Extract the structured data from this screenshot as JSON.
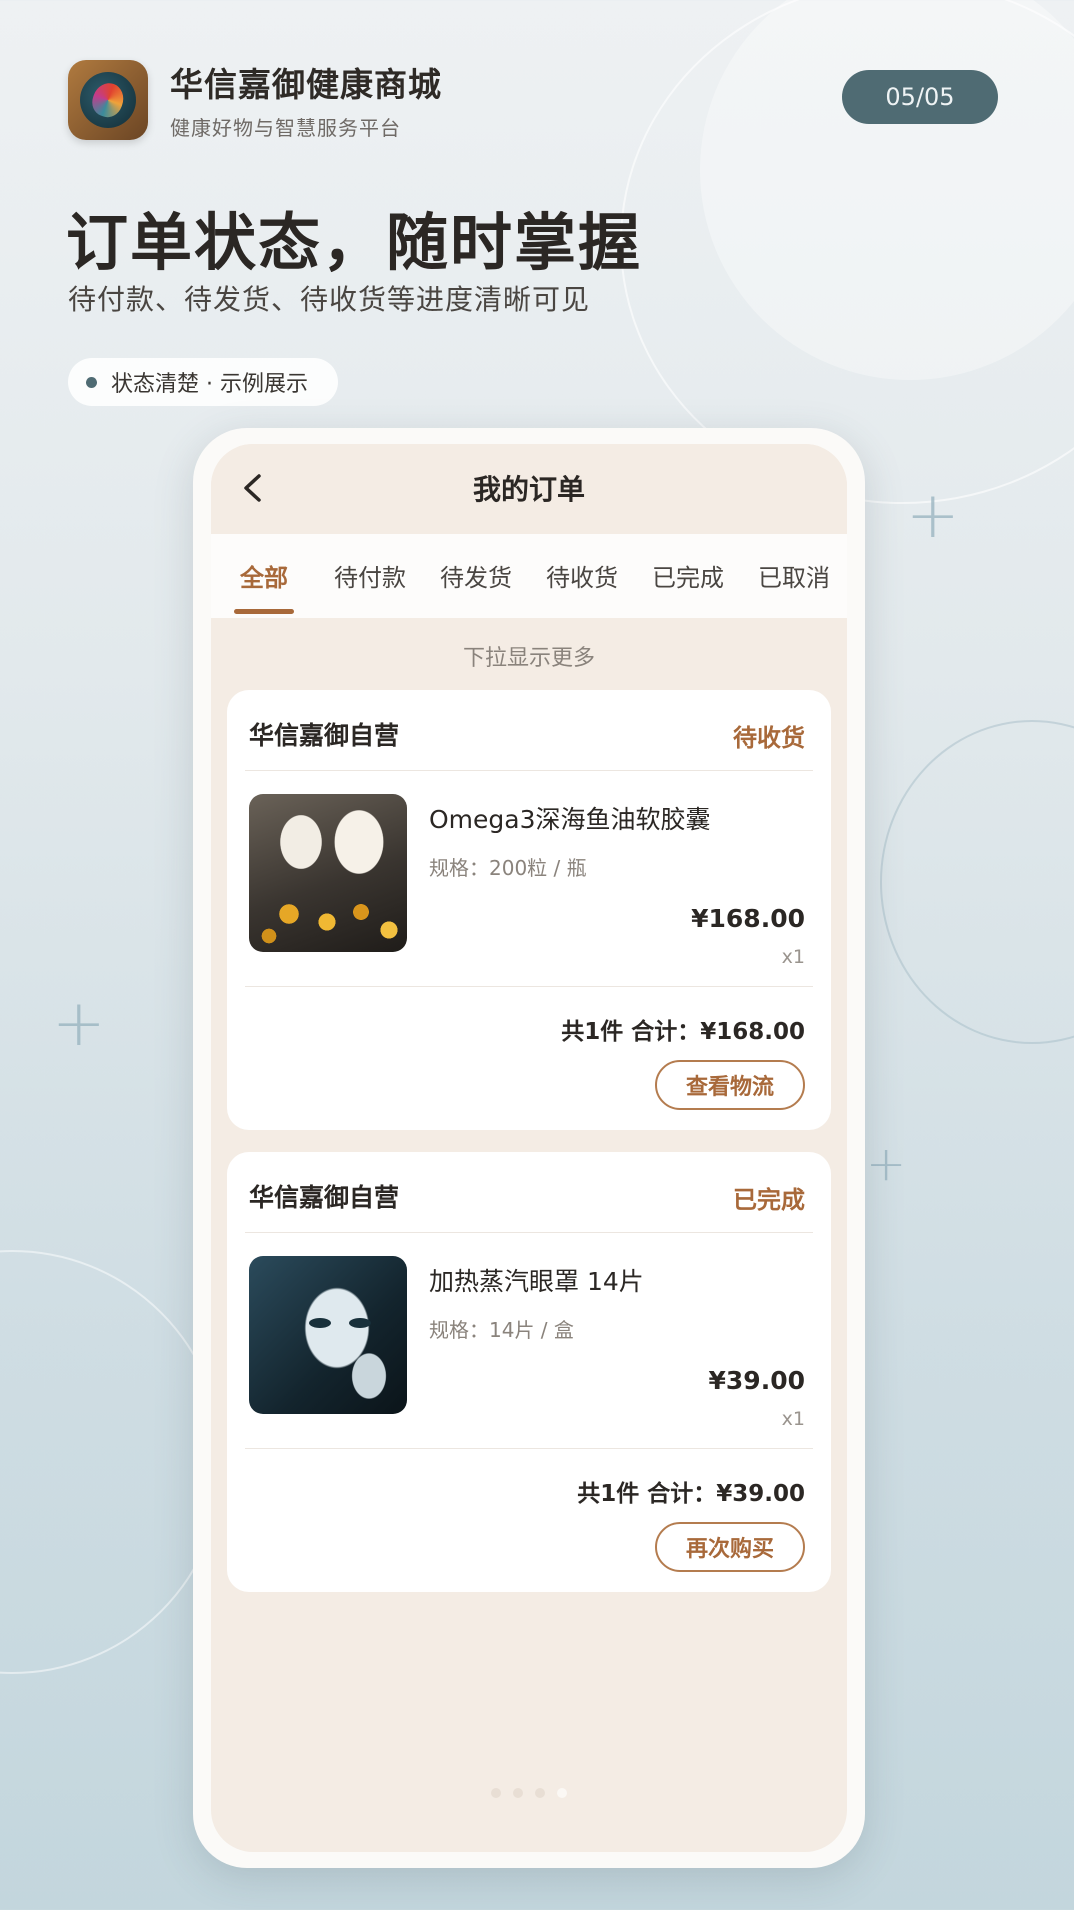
{
  "app": {
    "name": "华信嘉御健康商城",
    "subtitle": "健康好物与智慧服务平台",
    "page_indicator": "05/05"
  },
  "hero": {
    "title": "订单状态，随时掌握",
    "subtitle": "待付款、待发货、待收货等进度清晰可见",
    "tag": "状态清楚 · 示例展示"
  },
  "phone": {
    "nav_title": "我的订单",
    "back_icon": "chevron-left-icon",
    "tabs": [
      {
        "label": "全部",
        "active": true
      },
      {
        "label": "待付款",
        "active": false
      },
      {
        "label": "待发货",
        "active": false
      },
      {
        "label": "待收货",
        "active": false
      },
      {
        "label": "已完成",
        "active": false
      },
      {
        "label": "已取消",
        "active": false
      }
    ],
    "hint": "下拉显示更多",
    "orders": [
      {
        "store": "华信嘉御自营",
        "status": "待收货",
        "product_name": "Omega3深海鱼油软胶囊",
        "spec": "规格：200粒 / 瓶",
        "price": "¥168.00",
        "qty": "x1",
        "total": "共1件  合计：¥168.00",
        "action": "查看物流"
      },
      {
        "store": "华信嘉御自营",
        "status": "已完成",
        "product_name": "加热蒸汽眼罩 14片",
        "spec": "规格：14片 / 盒",
        "price": "¥39.00",
        "qty": "x1",
        "total": "共1件  合计：¥39.00",
        "action": "再次购买"
      }
    ],
    "carousel": {
      "count": 4,
      "active_index": 3
    }
  },
  "colors": {
    "accent": "#a8693a",
    "pill": "#4f6b73",
    "screen_bg": "#f4ece4"
  }
}
